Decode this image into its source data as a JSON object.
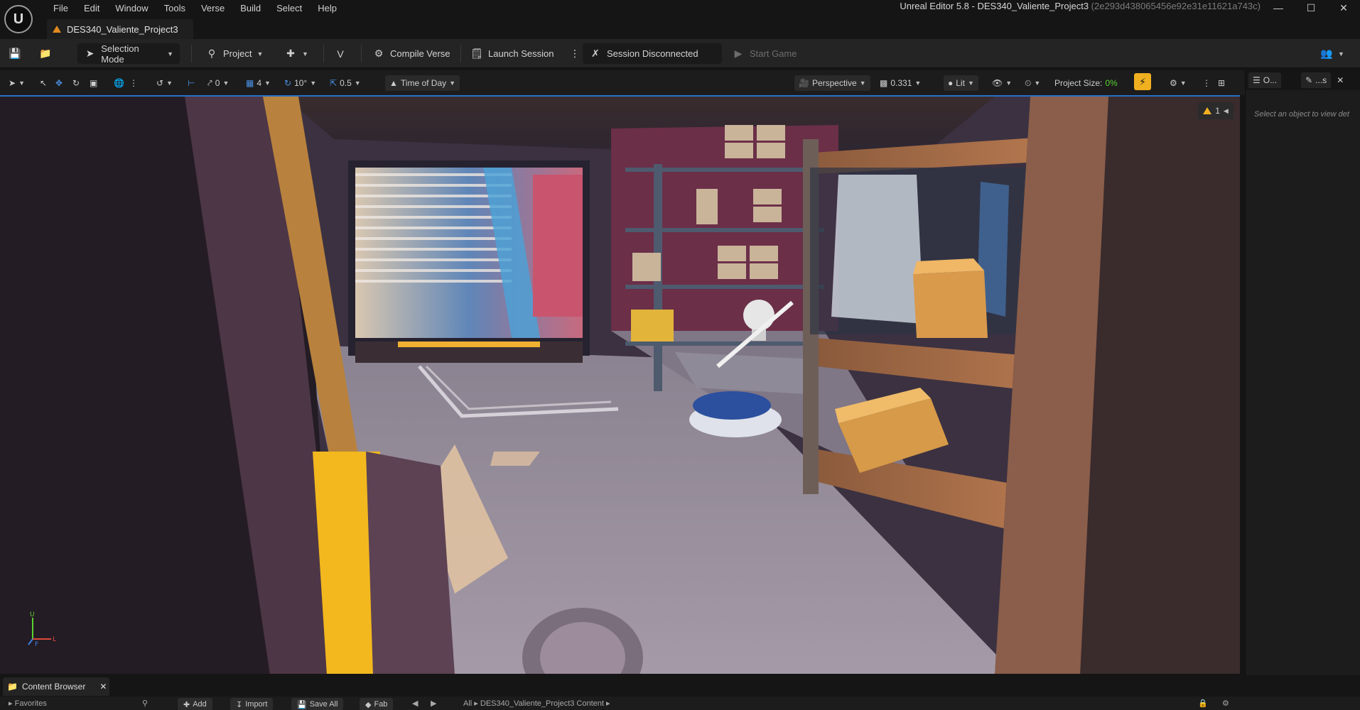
{
  "menu": [
    "File",
    "Edit",
    "Window",
    "Tools",
    "Verse",
    "Build",
    "Select",
    "Help"
  ],
  "window": {
    "title": "Unreal Editor 5.8 - DES340_Valiente_Project3",
    "hash": "(2e293d438065456e92e31e11621a743c)"
  },
  "doc_tab": {
    "label": "DES340_Valiente_Project3"
  },
  "toolbar": {
    "selection_mode": "Selection Mode",
    "project": "Project",
    "compile_verse": "Compile Verse",
    "launch_session": "Launch Session",
    "session_status": "Session Disconnected",
    "start_game": "Start Game"
  },
  "viewport_toolbar": {
    "rotation_snap": "0",
    "grid_size": "4",
    "angle_snap": "10°",
    "scale_snap": "0.5",
    "time_of_day": "Time of Day",
    "view_mode": "Perspective",
    "camera_speed": "0.331",
    "lighting": "Lit",
    "project_size_label": "Project Size:",
    "project_size_value": "0%"
  },
  "viewport": {
    "warning_count": "1"
  },
  "right_panel": {
    "tab_outliner": "O...",
    "tab_details": "...s",
    "empty_message": "Select an object to view det"
  },
  "bottom": {
    "content_browser_tab": "Content Browser",
    "favorites": "Favorites",
    "add": "Add",
    "import": "Import",
    "save_all": "Save All",
    "fab": "Fab",
    "path_all": "All",
    "path_content": "DES340_Valiente_Project3 Content"
  },
  "colors": {
    "accent": "#2a6fc9",
    "warning": "#f0b020",
    "ok": "#5ad132"
  }
}
